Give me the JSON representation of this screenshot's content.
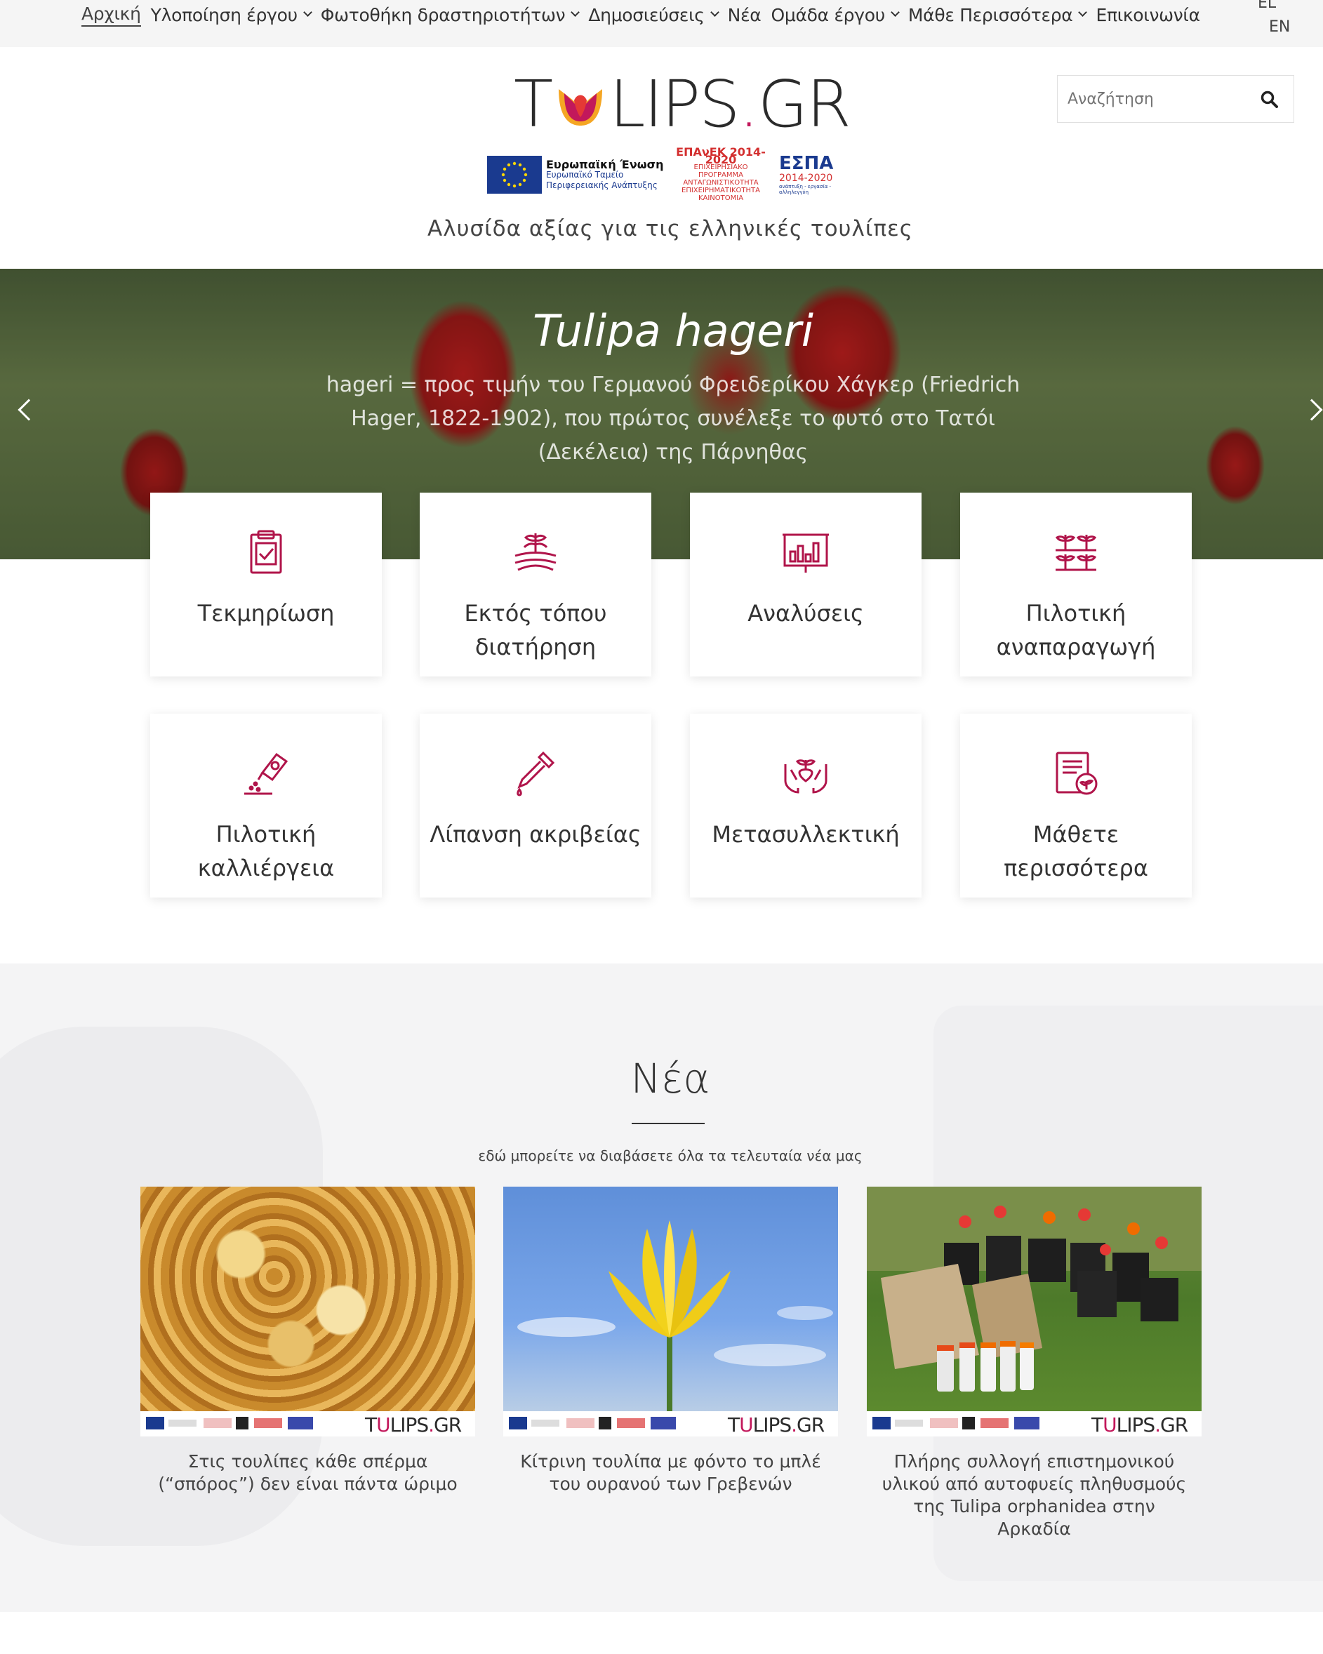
{
  "nav": {
    "items": [
      {
        "label": "Αρχική",
        "dropdown": false,
        "active": true
      },
      {
        "label": "Υλοποίηση έργου",
        "dropdown": true
      },
      {
        "label": "Φωτοθήκη δραστηριοτήτων",
        "dropdown": true
      },
      {
        "label": "Δημοσιεύσεις",
        "dropdown": true
      },
      {
        "label": "Νέα",
        "dropdown": false
      },
      {
        "label": "Ομάδα έργου",
        "dropdown": true
      },
      {
        "label": "Μάθε Περισσότερα",
        "dropdown": true
      },
      {
        "label": "Επικοινωνία",
        "dropdown": false
      }
    ],
    "lang_el": "EL",
    "lang_en": "EN"
  },
  "header": {
    "logo_left": "T",
    "logo_right": "LIPS",
    "logo_dot": ".",
    "logo_tld": "GR",
    "tagline": "Αλυσίδα αξίας για τις ελληνικές τουλίπες",
    "eu_title": "Ευρωπαϊκή Ένωση",
    "eu_sub": "Ευρωπαϊκό Ταμείο Περιφερειακής Ανάπτυξης",
    "epanek_title": "ΕΠΑνΕΚ 2014-2020",
    "epanek_sub": "ΕΠΙΧΕΙΡΗΣΙΑΚΟ ΠΡΟΓΡΑΜΜΑ ΑΝΤΑΓΩΝΙΣΤΙΚΟΤΗΤΑ ΕΠΙΧΕΙΡΗΜΑΤΙΚΟΤΗΤΑ ΚΑΙΝΟΤΟΜΙΑ",
    "espa_title": "ΕΣΠΑ",
    "espa_sub": "2014-2020",
    "espa_foot": "ανάπτυξη - εργασία - αλληλεγγύη"
  },
  "search": {
    "placeholder": "Αναζήτηση",
    "icon": "search-icon"
  },
  "hero": {
    "title": "Tulipa hageri",
    "description": "hageri = προς τιμήν του Γερμανού Φρειδερίκου Χάγκερ (Friedrich  Hager, 1822-1902), που πρώτος συνέλεξε το φυτό στο Τατόι (Δεκέλεια) της Πάρνηθας"
  },
  "cards": [
    {
      "label": "Τεκμηρίωση",
      "icon": "clipboard-check-icon"
    },
    {
      "label": "Εκτός τόπου διατήρηση",
      "icon": "plant-rows-icon"
    },
    {
      "label": "Αναλύσεις",
      "icon": "bar-chart-board-icon"
    },
    {
      "label": "Πιλοτική αναπαραγωγή",
      "icon": "seedlings-icon"
    },
    {
      "label": "Πιλοτική καλλιέργεια",
      "icon": "seed-packet-icon"
    },
    {
      "label": "Λίπανση ακριβείας",
      "icon": "dropper-icon"
    },
    {
      "label": "Μετασυλλεκτική",
      "icon": "hands-plant-icon"
    },
    {
      "label": "Μάθετε περισσότερα",
      "icon": "book-plant-icon"
    }
  ],
  "news": {
    "title": "Νέα",
    "subtitle": "εδώ μπορείτε να διαβάσετε όλα τα τελευταία νέα μας",
    "strip_brand_left": "T",
    "strip_brand_right": "LIPS",
    "strip_brand_dot": ".",
    "strip_brand_tld": "GR",
    "items": [
      {
        "caption": "Στις τουλίπες κάθε σπέρμα (“σπόρος”) δεν είναι πάντα ώριμο"
      },
      {
        "caption": "Κίτρινη τουλίπα με φόντο το μπλέ του ουρανού των Γρεβενών"
      },
      {
        "caption": "Πλήρης συλλογή επιστημονικού υλικού από αυτοφυείς πληθυσμούς της Tulipa orphanidea στην Αρκαδία"
      }
    ]
  },
  "colors": {
    "accent": "#c2185b",
    "icon": "#b0144a",
    "news_bg": "#f4f4f5",
    "nav_bg": "#f5f5f5"
  }
}
